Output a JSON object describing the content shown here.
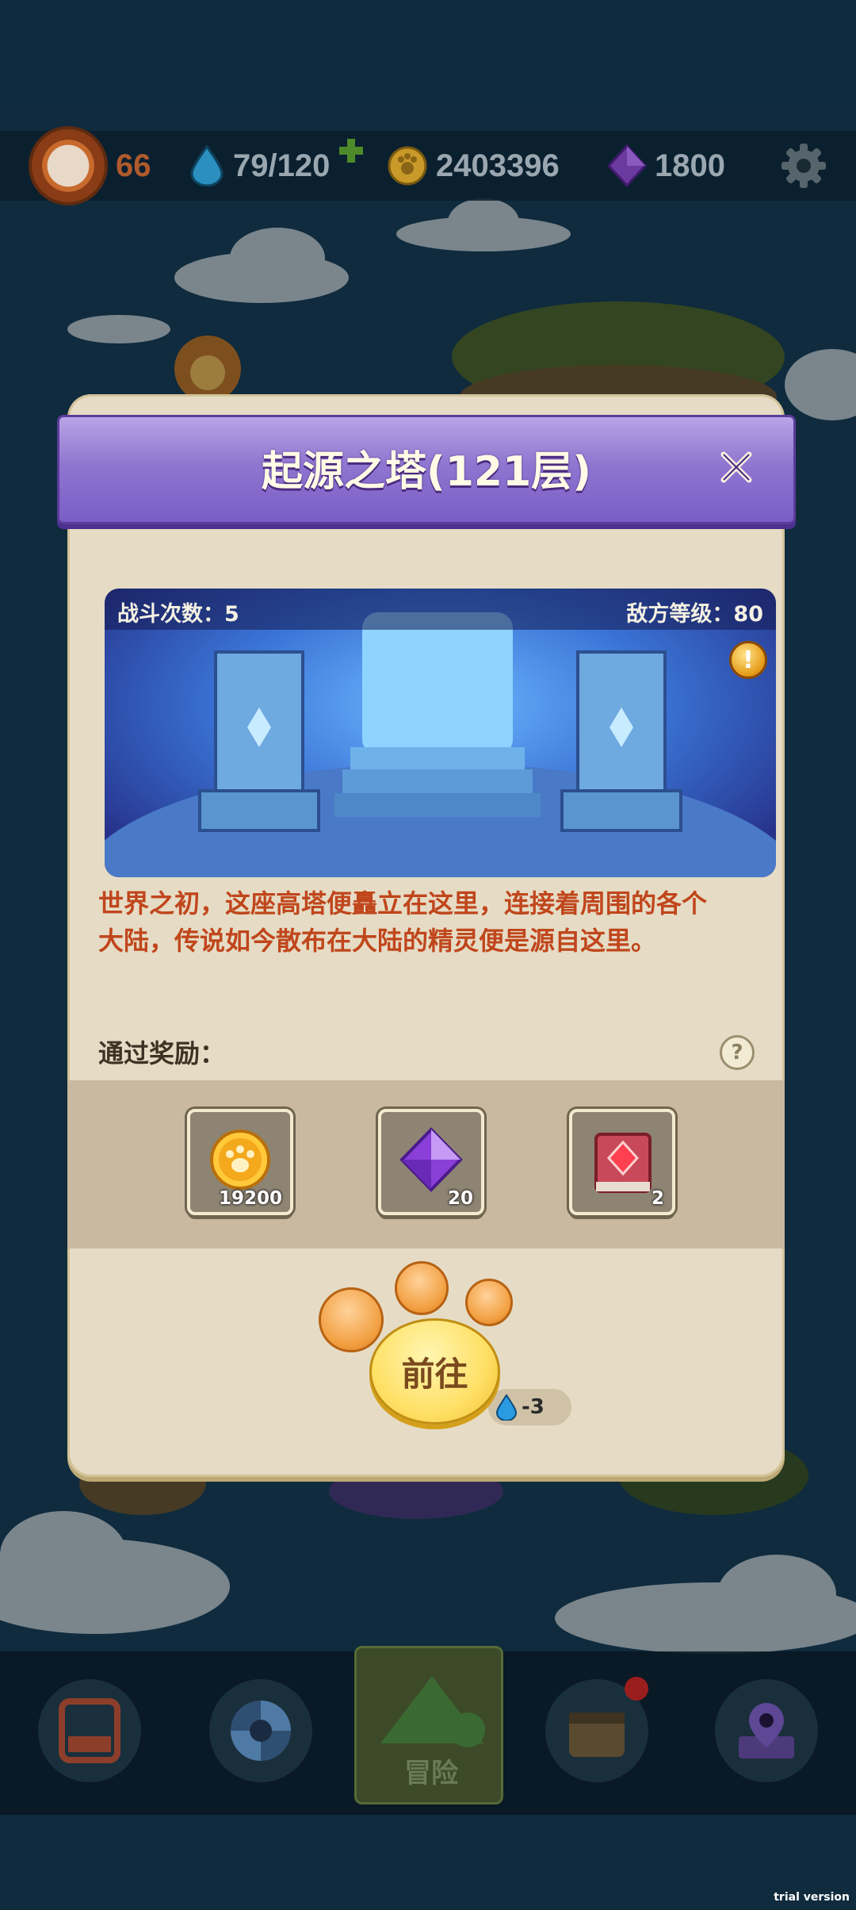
{
  "topbar": {
    "level": "66",
    "stamina": "79/120",
    "gold": "2403396",
    "gems": "1800"
  },
  "modal": {
    "title": "起源之塔(121层)",
    "battle_count": "战斗次数：5",
    "enemy_level": "敌方等级：80",
    "description_line1": "世界之初，这座高塔便矗立在这里，连接着周围的各个",
    "description_line2": "大陆，传说如今散布在大陆的精灵便是源自这里。",
    "reward_label": "通过奖励：",
    "rewards": [
      {
        "icon": "gold-coin-icon",
        "count": "19200"
      },
      {
        "icon": "purple-gem-icon",
        "count": "20"
      },
      {
        "icon": "red-book-icon",
        "count": "2"
      }
    ],
    "go_label": "前往",
    "cost": "-3"
  },
  "bottomnav": {
    "adventure_label": "冒险"
  },
  "watermark": "trial version",
  "colors": {
    "header_purple": "#8f76d0",
    "description_red": "#c0461c",
    "panel_beige": "#e6dcc5",
    "go_yellow": "#ffe066"
  }
}
